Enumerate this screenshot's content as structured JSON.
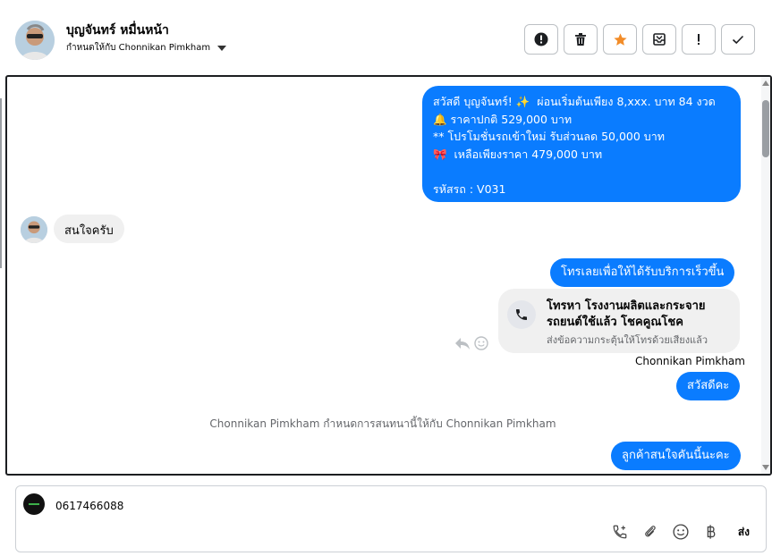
{
  "header": {
    "contact_name": "บุญจันทร์ หมื่นหน้า",
    "assigned_text": "กำหนดให้กับ Chonnikan Pimkham"
  },
  "messages": {
    "promo_lines": [
      "สวัสดี บุญจันทร์! ✨  ผ่อนเริ่มต้นเพียง 8,xxx. บาท 84 งวด",
      "🔔 ราคาปกติ 529,000 บาท",
      "** โปรโมชั่นรถเข้าใหม่ รับส่วนลด 50,000 บาท",
      "🎀  เหลือเพียงราคา 479,000 บาท",
      "",
      "รหัสรถ : V031"
    ],
    "incoming_1": "สนใจครับ",
    "outgoing_2": "โทรเลยเพื่อให้ได้รับบริการเร็วขึ้น",
    "call_card_title": "โทรหา โรงงานผลิตและกระจาย รถยนต์ใช้แล้ว โชคคูณโชค",
    "call_card_sub": "ส่งข้อความกระตุ้นให้โทรด้วยเสียงแล้ว",
    "sender_name": "Chonnikan Pimkham",
    "outgoing_3": "สวัสดีคะ",
    "system_message": "Chonnikan Pimkham กำหนดการสนทนานี้ให้กับ Chonnikan Pimkham",
    "outgoing_4": "ลูกค้าสนใจคันนี้นะคะ"
  },
  "composer": {
    "text": "0617466088",
    "send_label": "ส่ง"
  },
  "colors": {
    "accent": "#0a7cff",
    "incoming_bg": "#f0f0f0",
    "star": "#f28c28"
  },
  "icons": {
    "toolbar": [
      "alert-circle-icon",
      "trash-icon",
      "star-icon",
      "archive-icon",
      "exclamation-icon",
      "check-icon"
    ],
    "composer": [
      "add-call-icon",
      "attachment-icon",
      "emoji-icon",
      "baht-icon"
    ]
  }
}
